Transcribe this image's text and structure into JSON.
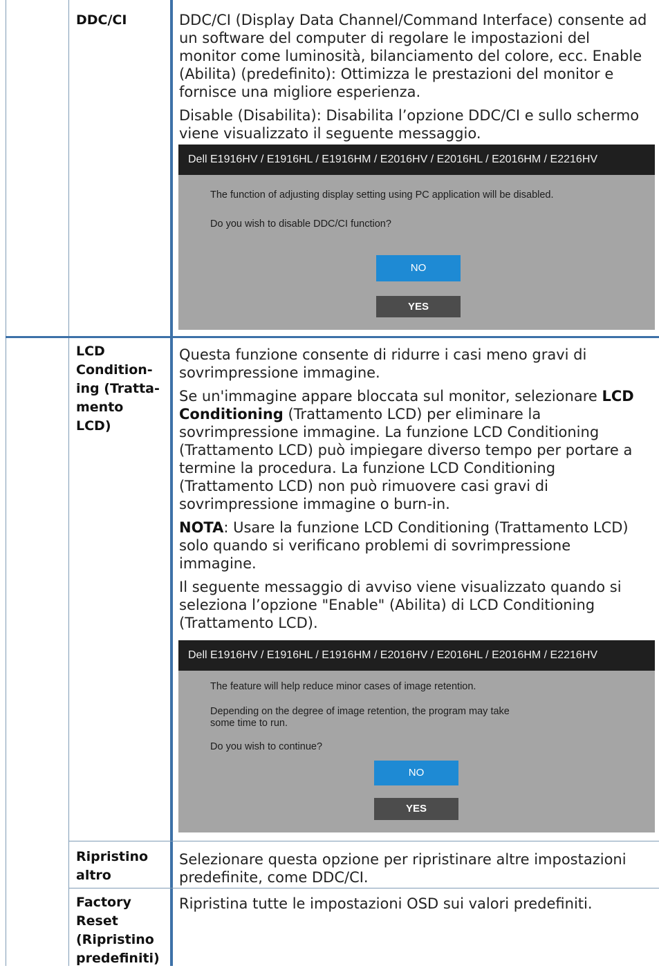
{
  "rows": {
    "ddcci": {
      "label": "DDC/CI",
      "p1": "DDC/CI (Display Data Channel/Command Interface) consente ad un software del computer di regolare le impostazioni del monitor come luminosità, bilanciamento del colore, ecc. Enable (Abilita) (predefinito): Ottimizza le prestazioni del monitor e fornisce una migliore esperienza.",
      "p2": "Disable (Disabilita): Disabilita l’opzione DDC/CI e sullo schermo viene visualizzato il seguente messaggio.",
      "osd": {
        "title": "Dell E1916HV / E1916HL / E1916HM / E2016HV / E2016HL / E2016HM / E2216HV",
        "msg1": "The function of adjusting display setting using PC application will be disabled.",
        "msg2": "Do you wish to disable DDC/CI function?",
        "no": "NO",
        "yes": "YES"
      }
    },
    "lcd": {
      "label": "LCD Condition-ing (Tratta-mento LCD)",
      "p1": "Questa funzione consente di ridurre i casi meno gravi di sovrimpressione immagine.",
      "p2_pre": "Se un'immagine appare bloccata sul monitor, selezionare ",
      "p2_bold": "LCD Conditioning",
      "p2_post": " (Trattamento LCD) per eliminare la sovrimpressione immagine. La funzione LCD Conditioning (Trattamento LCD) può impiegare diverso tempo per portare a termine la procedura. La funzione LCD Conditioning (Trattamento LCD) non può rimuovere casi gravi di sovrimpressione immagine o burn-in.",
      "p3_bold": "NOTA",
      "p3_post": ": Usare la funzione LCD Conditioning (Trattamento LCD) solo quando si verificano problemi di sovrimpressione immagine.",
      "p4": "Il seguente messaggio di avviso viene visualizzato quando si seleziona l’opzione \"Enable\" (Abilita) di LCD Conditioning (Trattamento LCD).",
      "osd": {
        "title": "Dell E1916HV / E1916HL / E1916HM / E2016HV / E2016HL / E2016HM / E2216HV",
        "msg1": "The feature will help reduce minor cases of image retention.",
        "msg2a": "Depending on the degree of image retention, the program may take",
        "msg2b": "some time to run.",
        "msg3": "Do you wish to continue?",
        "no": "NO",
        "yes": "YES"
      }
    },
    "other_reset": {
      "label": "Ripristino altro",
      "desc": "Selezionare questa opzione per ripristinare altre impostazioni predefinite, come DDC/CI."
    },
    "factory_reset": {
      "label": "Factory Reset (Ripristino predefiniti)",
      "desc": "Ripristina tutte le impostazioni OSD sui valori predefiniti."
    }
  }
}
